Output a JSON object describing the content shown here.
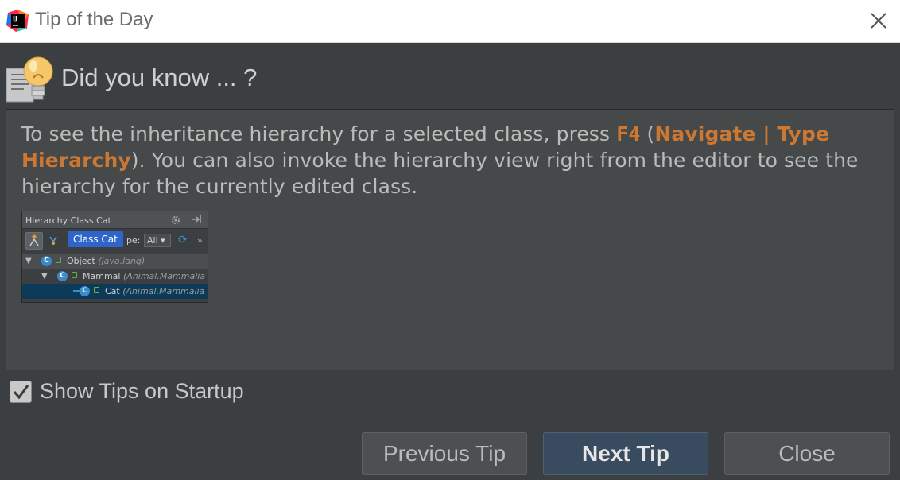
{
  "window": {
    "title": "Tip of the Day"
  },
  "header": {
    "text": "Did you know ... ?"
  },
  "tip": {
    "part1": "To see the inheritance hierarchy for a selected class, press ",
    "shortcut": "F4",
    "part2": " (",
    "menu_path": "Navigate | Type Hierarchy",
    "part3": "). You can also invoke the hierarchy view right from the editor to see the hierarchy for the currently edited class."
  },
  "preview": {
    "panel_title": "Hierarchy Class Cat",
    "tooltip": "Class Cat",
    "scope_label": "pe:",
    "scope_value": "All",
    "more": "»",
    "rows": [
      {
        "badge": "C",
        "name": "Object",
        "pkg": "(java.lang)"
      },
      {
        "badge": "C",
        "name": "Mammal",
        "pkg": "(Animal.Mammalia"
      },
      {
        "badge": "C",
        "name": "Cat",
        "pkg": "(Animal.Mammalia"
      }
    ]
  },
  "options": {
    "show_tips_label": "Show Tips on Startup",
    "show_tips_checked": true
  },
  "buttons": {
    "previous": "Previous Tip",
    "next": "Next Tip",
    "close": "Close"
  },
  "colors": {
    "accent": "#cc7832",
    "background": "#3c3f41",
    "panel": "#45494a",
    "default_button": "#384b5f"
  },
  "icons": {
    "app": "intellij-logo-icon",
    "header": "lightbulb-document-icon"
  }
}
